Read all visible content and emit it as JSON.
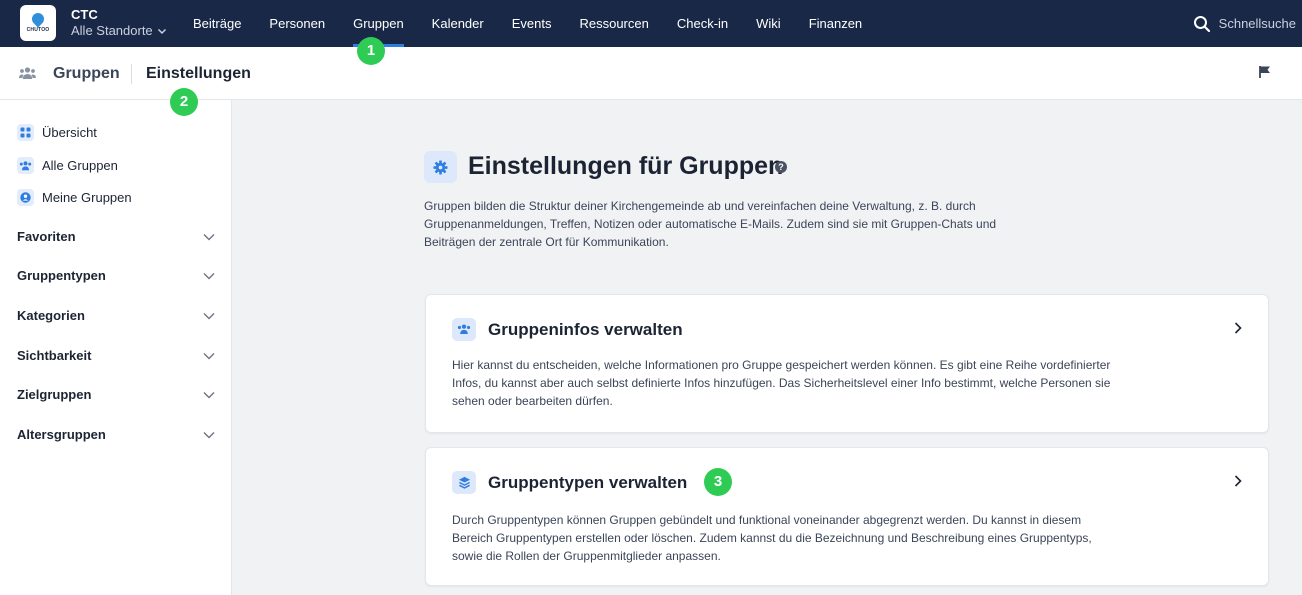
{
  "brand": {
    "logo_text": "CHUTOO",
    "org_name": "CTC",
    "location": "Alle Standorte"
  },
  "nav": {
    "items": [
      {
        "label": "Beiträge",
        "active": false
      },
      {
        "label": "Personen",
        "active": false
      },
      {
        "label": "Gruppen",
        "active": true
      },
      {
        "label": "Kalender",
        "active": false
      },
      {
        "label": "Events",
        "active": false
      },
      {
        "label": "Ressourcen",
        "active": false
      },
      {
        "label": "Check-in",
        "active": false
      },
      {
        "label": "Wiki",
        "active": false
      },
      {
        "label": "Finanzen",
        "active": false
      }
    ],
    "search_label": "Schnellsuche"
  },
  "breadcrumb": {
    "section": "Gruppen",
    "page": "Einstellungen"
  },
  "sidebar": {
    "links": [
      {
        "label": "Übersicht",
        "icon": "grid-icon"
      },
      {
        "label": "Alle Gruppen",
        "icon": "users-icon"
      },
      {
        "label": "Meine Gruppen",
        "icon": "user-circle-icon"
      }
    ],
    "sections": [
      {
        "label": "Favoriten"
      },
      {
        "label": "Gruppentypen"
      },
      {
        "label": "Kategorien"
      },
      {
        "label": "Sichtbarkeit"
      },
      {
        "label": "Zielgruppen"
      },
      {
        "label": "Altersgruppen"
      }
    ]
  },
  "main": {
    "title": "Einstellungen für Gruppen",
    "intro": "Gruppen bilden die Struktur deiner Kirchengemeinde ab und vereinfachen deine Verwaltung, z. B. durch Gruppenanmeldungen, Treffen, Notizen oder automatische E-Mails. Zudem sind sie mit Gruppen-Chats und Beiträgen der zentrale Ort für Kommunikation.",
    "cards": [
      {
        "title": "Gruppeninfos verwalten",
        "text": "Hier kannst du entscheiden, welche Informationen pro Gruppe gespeichert werden können. Es gibt eine Reihe vordefinierter Infos, du kannst aber auch selbst definierte Infos hinzufügen. Das Sicherheitslevel einer Info bestimmt, welche Personen sie sehen oder bearbeiten dürfen."
      },
      {
        "title": "Gruppentypen verwalten",
        "text": "Durch Gruppentypen können Gruppen gebündelt und funktional voneinander abgegrenzt werden. Du kannst in diesem Bereich Gruppentypen erstellen oder löschen. Zudem kannst du die Bezeichnung und Beschreibung eines Gruppentyps, sowie die Rollen der Gruppenmitglieder anpassen."
      }
    ]
  },
  "markers": [
    "1",
    "2",
    "3"
  ],
  "colors": {
    "navbar": "#1a2847",
    "accent": "#2f7de1",
    "marker": "#2ecc54"
  }
}
